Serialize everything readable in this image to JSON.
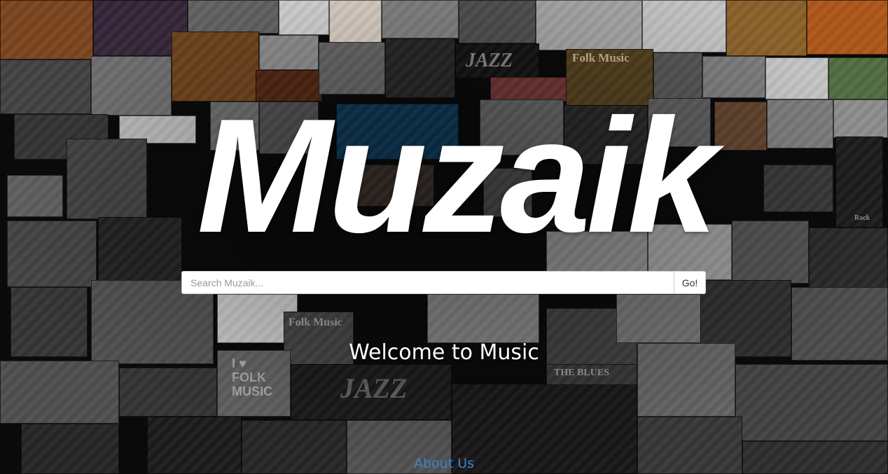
{
  "brand": {
    "logo_text": "Muzaik"
  },
  "search": {
    "placeholder": "Search Muzaik...",
    "value": "",
    "button_label": "Go!"
  },
  "hero": {
    "welcome_text": "Welcome to Music"
  },
  "footer": {
    "about_link": "About Us"
  },
  "collage": {
    "visible_labels": [
      "Folk Music",
      "JAZZ",
      "I ♥ FOLK MUSIC",
      "JAZZ",
      "Folk Music",
      "THE BLUES",
      "Rock"
    ]
  },
  "colors": {
    "background": "#0b0b0b",
    "logo": "#ffffff",
    "link": "#3a86c8"
  }
}
